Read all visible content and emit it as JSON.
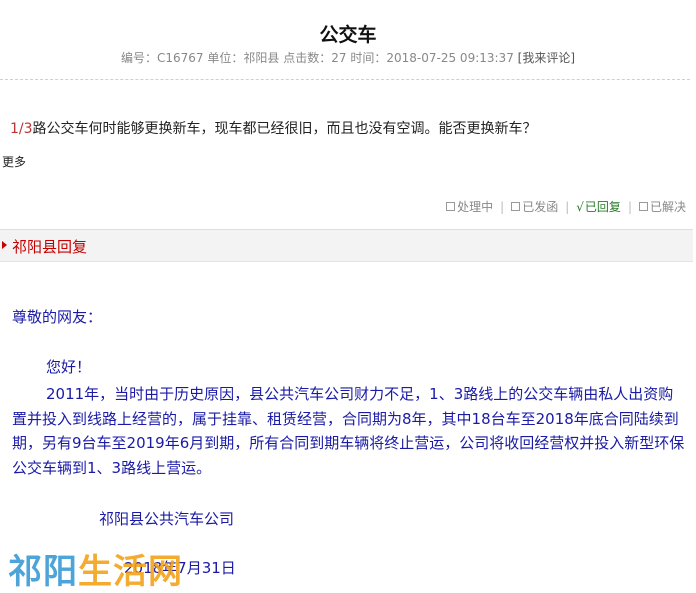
{
  "article": {
    "title": "公交车",
    "meta": {
      "id_label": "编号：",
      "id": "C16767",
      "unit_label": "单位：",
      "unit": "祁阳县",
      "clicks_label": "点击数：",
      "clicks": "27",
      "time_label": "时间：",
      "time": "2018-07-25 09:13:37",
      "comment_link": "[我来评论]"
    },
    "question_num": "1/3",
    "question_text": "路公交车何时能够更换新车，现车都已经很旧，而且也没有空调。能否更换新车？",
    "more_label": "更多"
  },
  "status_bar": {
    "items": [
      {
        "label": "处理中",
        "active": false
      },
      {
        "label": "已发函",
        "active": false
      },
      {
        "label": "已回复",
        "active": true
      },
      {
        "label": "已解决",
        "active": false
      }
    ],
    "separator": "|"
  },
  "reply": {
    "header_title": "祁阳县回复",
    "salutation": "尊敬的网友：",
    "greeting": "您好！",
    "paragraph": "2011年，当时由于历史原因，县公共汽车公司财力不足，1、3路线上的公交车辆由私人出资购置并投入到线路上经营的，属于挂靠、租赁经营，合同期为8年，其中18台车至2018年底合同陆续到期，另有9台车至2019年6月到期，所有合同到期车辆将终止营运，公司将收回经营权并投入新型环保公交车辆到1、3路线上营运。",
    "signature": "祁阳县公共汽车公司",
    "date": "2018年7月31日"
  },
  "watermark": {
    "part1": "祁阳",
    "part2": "生活网"
  },
  "colors": {
    "reply_text": "#1a1aa6",
    "header_red": "#c40000",
    "status_active": "#2a7a2a"
  }
}
